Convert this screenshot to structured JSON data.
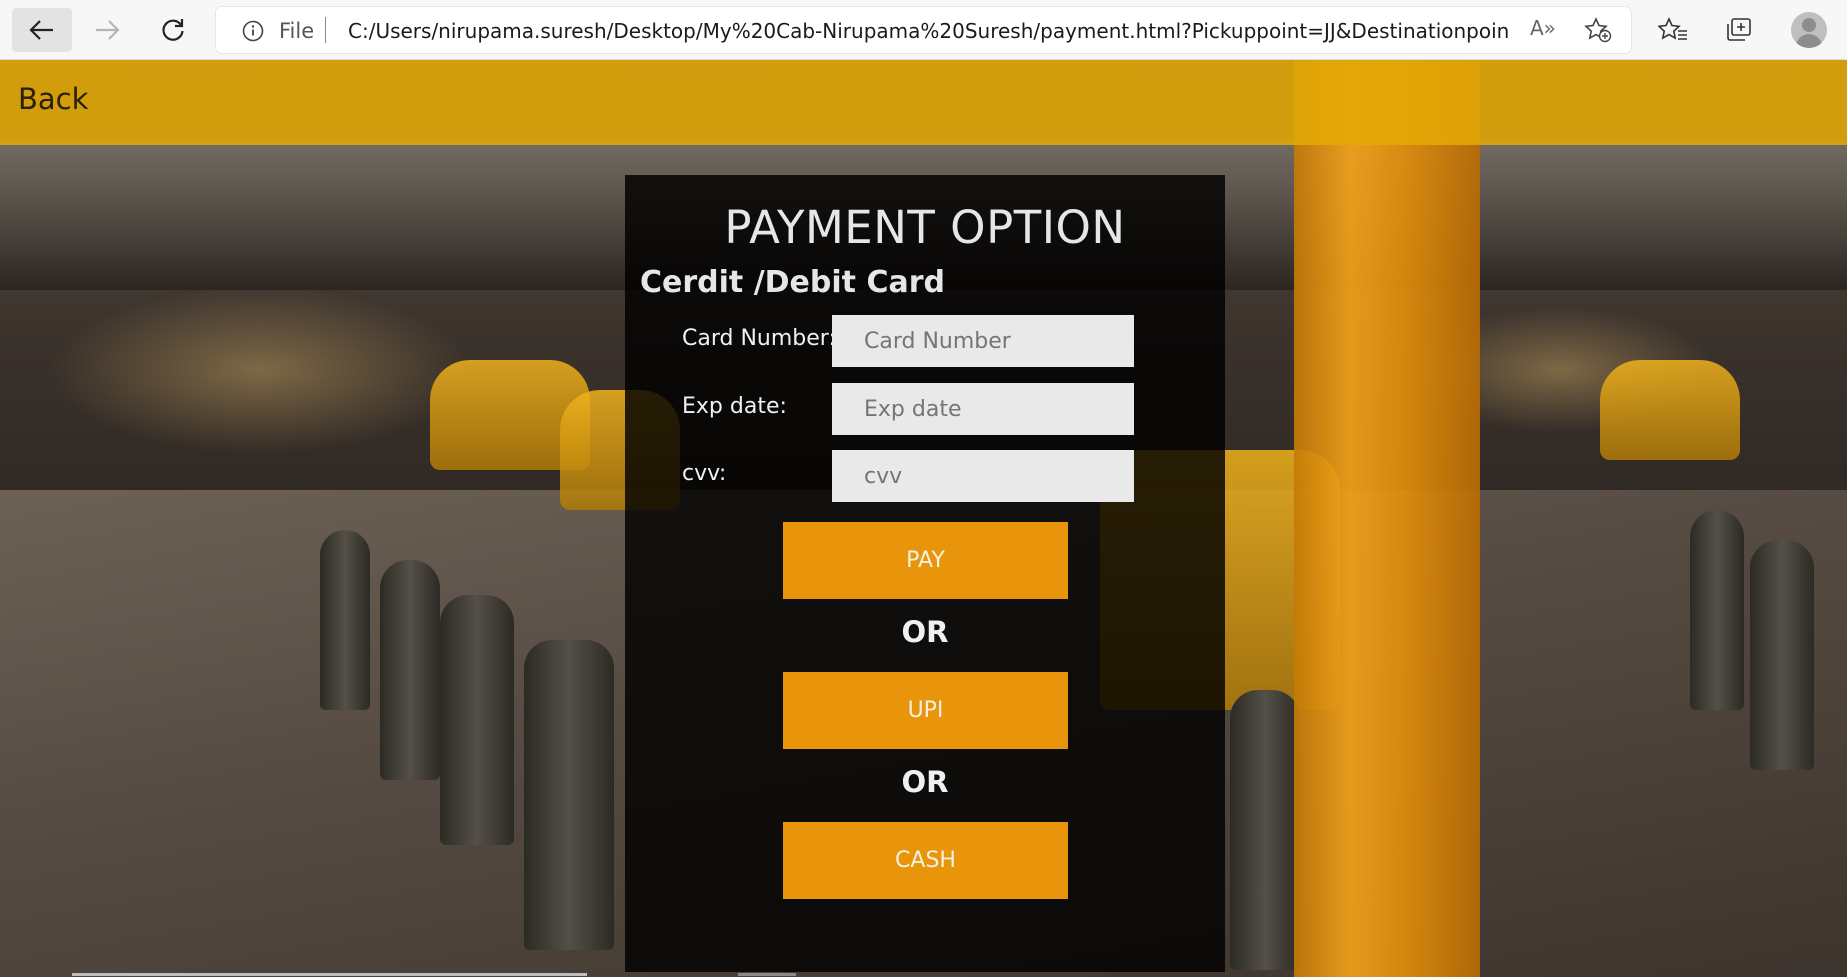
{
  "browser": {
    "file_label": "File",
    "url": "C:/Users/nirupama.suresh/Desktop/My%20Cab-Nirupama%20Suresh/payment.html?Pickuppoint=JJ&Destinationpoint=qwer...",
    "read_aloud_label": "A»"
  },
  "header": {
    "back_label": "Back",
    "accent_color": "#e2a806"
  },
  "payment": {
    "title": "PAYMENT OPTION",
    "section_title": "Cerdit /Debit Card",
    "fields": {
      "card_number": {
        "label": "Card Number:",
        "placeholder": "Card Number"
      },
      "exp_date": {
        "label": "Exp date:",
        "placeholder": "Exp date"
      },
      "cvv": {
        "label": "cvv:",
        "placeholder": "cvv"
      }
    },
    "pay_label": "PAY",
    "or_label": "OR",
    "upi_label": "UPI",
    "or_label_2": "OR",
    "cash_label": "CASH",
    "button_color": "#e8950c"
  }
}
